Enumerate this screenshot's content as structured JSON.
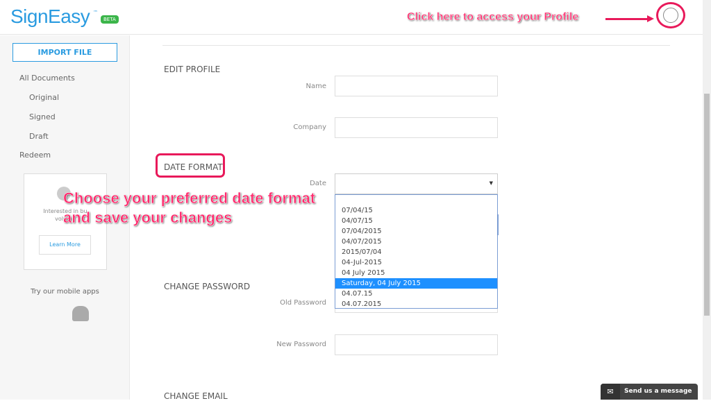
{
  "header": {
    "logo": "SignEasy",
    "tm": "™",
    "beta": "BETA",
    "profile_hint": "Click here to access your Profile"
  },
  "sidebar": {
    "import": "IMPORT FILE",
    "items": [
      "All Documents",
      "Original",
      "Signed",
      "Draft",
      "Redeem"
    ],
    "promo": {
      "line1": "Interested in bu",
      "line2": "volume",
      "learn_more": "Learn More"
    },
    "mobile": "Try our mobile apps"
  },
  "main": {
    "edit_profile": "EDIT PROFILE",
    "name_label": "Name",
    "company_label": "Company",
    "date_format": "DATE FORMAT",
    "date_label": "Date",
    "date_options": [
      "07/04/15",
      "04/07/15",
      "07/04/2015",
      "04/07/2015",
      "2015/07/04",
      "04-Jul-2015",
      "04 July 2015",
      "Saturday, 04 July 2015",
      "04.07.15",
      "04.07.2015"
    ],
    "highlighted_option": "Saturday, 04 July 2015",
    "change_password": "CHANGE PASSWORD",
    "old_password": "Old Password",
    "new_password": "New Password",
    "change_email": "CHANGE EMAIL"
  },
  "annotation": {
    "line1": "Choose your preferred date format",
    "line2": "and save your changes"
  },
  "chat": {
    "label": "Send us a message"
  },
  "colors": {
    "accent": "#2a9be0",
    "highlight": "#e8195a",
    "beta": "#3bb54a"
  }
}
